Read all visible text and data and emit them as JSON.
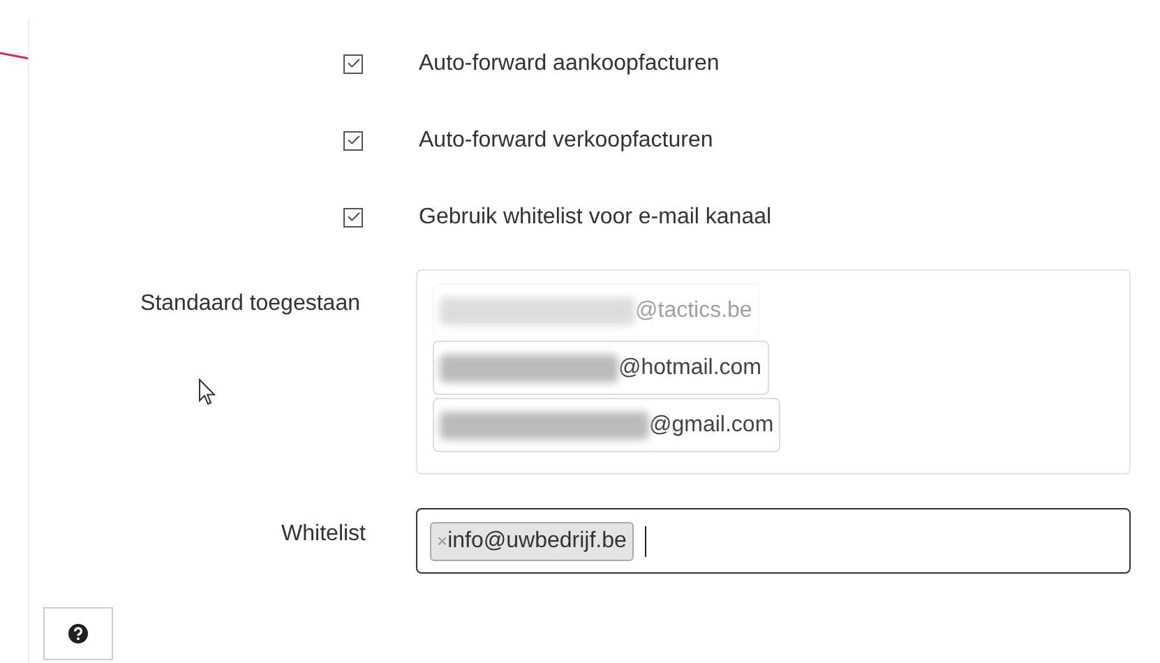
{
  "options": [
    {
      "label": "Auto-forward aankoopfacturen",
      "checked": true
    },
    {
      "label": "Auto-forward verkoopfacturen",
      "checked": true
    },
    {
      "label": "Gebruik whitelist voor e-mail kanaal",
      "checked": true
    }
  ],
  "default_allowed": {
    "label": "Standaard toegestaan",
    "items": [
      {
        "domain": "@tactics.be",
        "faded": true
      },
      {
        "domain": "@hotmail.com",
        "faded": false
      },
      {
        "domain": "@gmail.com",
        "faded": false
      }
    ]
  },
  "whitelist": {
    "label": "Whitelist",
    "tags": [
      {
        "remove": "×",
        "text": "info@uwbedrijf.be"
      }
    ]
  }
}
